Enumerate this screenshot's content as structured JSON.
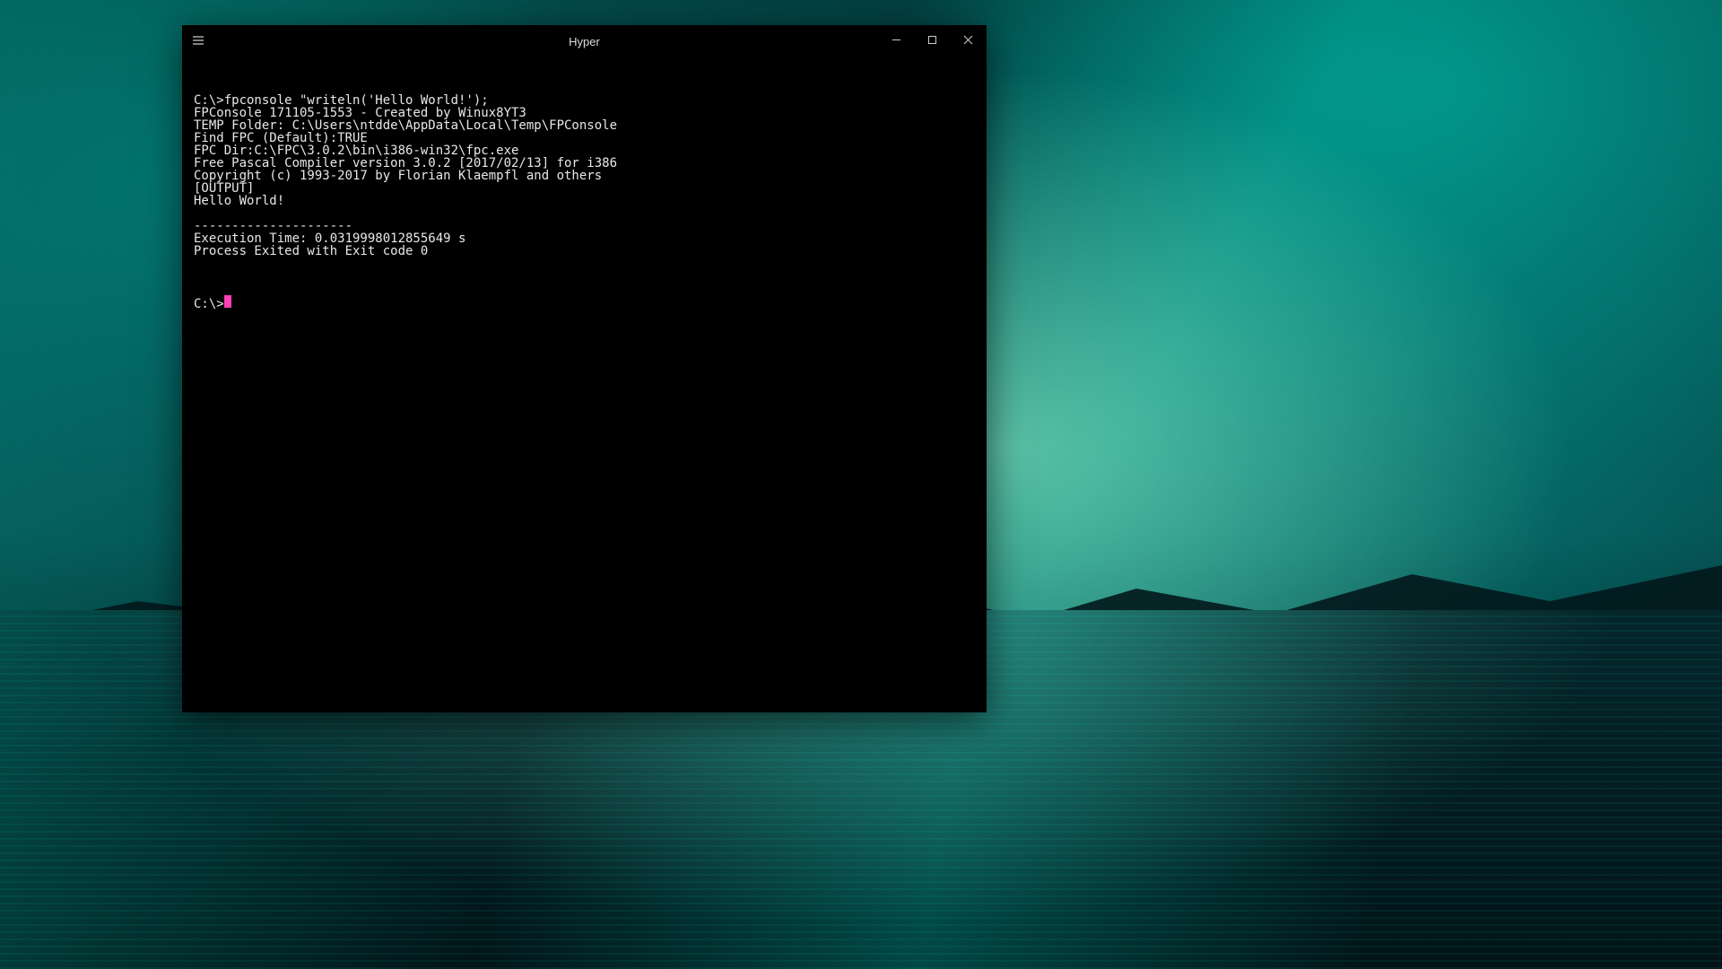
{
  "window": {
    "title": "Hyper"
  },
  "terminal": {
    "lines": [
      "C:\\>fpconsole \"writeln('Hello World!');",
      "FPConsole 171105-1553 - Created by Winux8YT3",
      "TEMP Folder: C:\\Users\\ntdde\\AppData\\Local\\Temp\\FPConsole",
      "Find FPC (Default):TRUE",
      "FPC Dir:C:\\FPC\\3.0.2\\bin\\i386-win32\\fpc.exe",
      "Free Pascal Compiler version 3.0.2 [2017/02/13] for i386",
      "Copyright (c) 1993-2017 by Florian Klaempfl and others",
      "[OUTPUT]",
      "Hello World!",
      "",
      "---------------------",
      "Execution Time: 0.0319998012855649 s",
      "Process Exited with Exit code 0",
      ""
    ],
    "prompt": "C:\\>"
  }
}
